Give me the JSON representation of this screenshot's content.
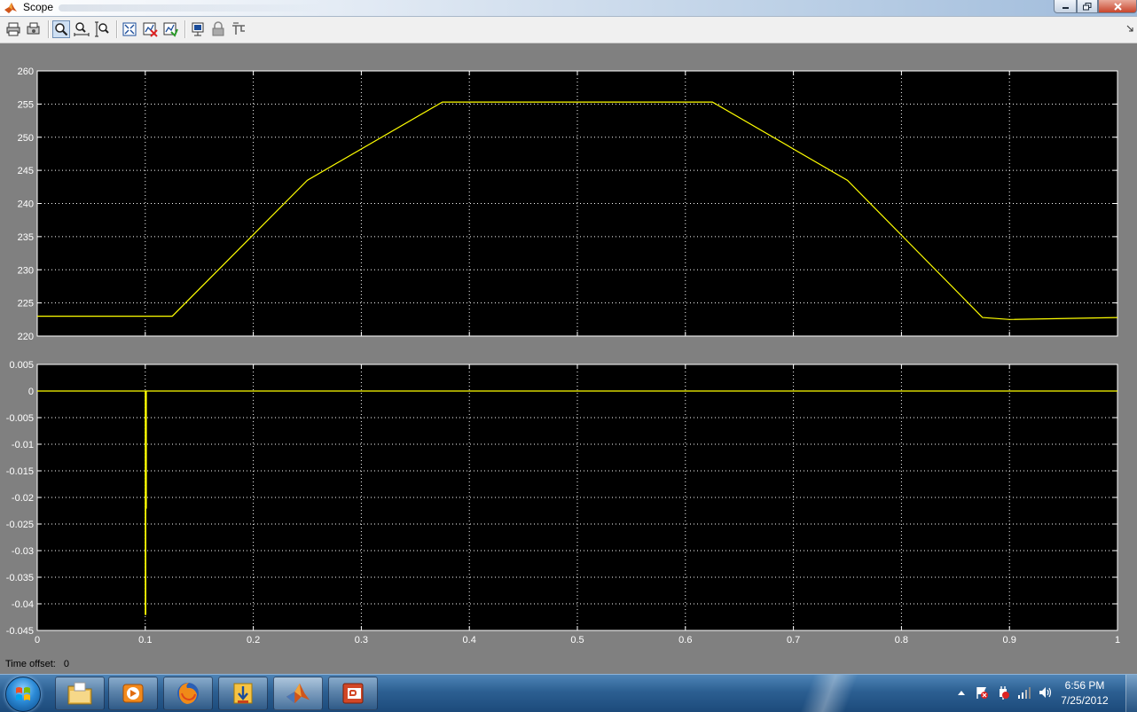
{
  "window": {
    "title": "Scope"
  },
  "toolbar": {
    "buttons": [
      {
        "name": "print-icon"
      },
      {
        "name": "parameters-icon"
      },
      {
        "name": "zoom-icon",
        "active": true
      },
      {
        "name": "zoom-x-icon"
      },
      {
        "name": "zoom-y-icon"
      },
      {
        "name": "autoscale-icon"
      },
      {
        "name": "save-axes-icon"
      },
      {
        "name": "restore-axes-icon"
      },
      {
        "name": "floating-scope-icon"
      },
      {
        "name": "lock-icon"
      },
      {
        "name": "signal-selection-icon"
      }
    ]
  },
  "chart_data": [
    {
      "type": "line",
      "xlim": [
        0,
        1
      ],
      "ylim": [
        220,
        260
      ],
      "y_ticks": [
        "220",
        "225",
        "230",
        "235",
        "240",
        "245",
        "250",
        "255",
        "260"
      ],
      "grid": true,
      "background": "#000000",
      "line_color": "#ffff00",
      "series": [
        {
          "x": [
            0,
            0.125,
            0.25,
            0.375,
            0.625,
            0.75,
            0.875,
            0.9,
            1.0
          ],
          "y": [
            223,
            223,
            243.5,
            255.3,
            255.3,
            243.5,
            222.8,
            222.5,
            222.8
          ]
        }
      ]
    },
    {
      "type": "line",
      "xlim": [
        0,
        1
      ],
      "ylim": [
        -0.045,
        0.005
      ],
      "y_ticks": [
        "-0.045",
        "-0.04",
        "-0.035",
        "-0.03",
        "-0.025",
        "-0.02",
        "-0.015",
        "-0.01",
        "-0.005",
        "0",
        "0.005"
      ],
      "x_ticks": [
        "0",
        "0.1",
        "0.2",
        "0.3",
        "0.4",
        "0.5",
        "0.6",
        "0.7",
        "0.8",
        "0.9",
        "1"
      ],
      "grid": true,
      "background": "#000000",
      "line_color": "#ffff00",
      "series": [
        {
          "x": [
            0,
            0.1,
            0.1,
            0.1005,
            0.1005,
            0.101,
            0.101,
            1.0
          ],
          "y": [
            0,
            0,
            -0.042,
            -0.042,
            -0.022,
            -0.022,
            0,
            0
          ]
        }
      ]
    }
  ],
  "status": {
    "label": "Time offset:",
    "value": "0"
  },
  "taskbar": {
    "apps": [
      {
        "name": "explorer-icon"
      },
      {
        "name": "media-player-icon"
      },
      {
        "name": "firefox-icon"
      },
      {
        "name": "installer-icon"
      },
      {
        "name": "matlab-icon",
        "active": true
      },
      {
        "name": "simulink-ppt-icon"
      }
    ],
    "clock": {
      "time": "6:56 PM",
      "date": "7/25/2012"
    }
  }
}
